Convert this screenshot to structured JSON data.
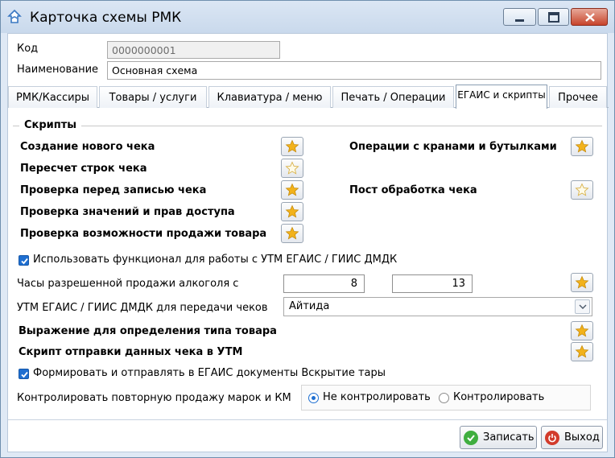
{
  "window": {
    "title": "Карточка схемы РМК",
    "controls": {
      "minimize_icon": "minimize-icon",
      "maximize_icon": "maximize-icon",
      "close_icon": "close-icon"
    }
  },
  "fields": {
    "code_label": "Код",
    "code_value": "0000000001",
    "name_label": "Наименование",
    "name_value": "Основная схема"
  },
  "tabs": [
    {
      "label": "РМК/Кассиры",
      "active": false
    },
    {
      "label": "Товары / услуги",
      "active": false
    },
    {
      "label": "Клавиатура / меню",
      "active": false
    },
    {
      "label": "Печать / Операции",
      "active": false
    },
    {
      "label": "ЕГАИС и скрипты",
      "active": true
    },
    {
      "label": "Прочее",
      "active": false
    }
  ],
  "scripts": {
    "group_title": "Скрипты",
    "left": [
      {
        "label": "Создание нового чека",
        "star_filled": true
      },
      {
        "label": "Пересчет строк чека",
        "star_filled": false
      },
      {
        "label": "Проверка перед записью чека",
        "star_filled": true
      },
      {
        "label": "Проверка значений и прав доступа",
        "star_filled": true
      },
      {
        "label": "Проверка возможности продажи товара",
        "star_filled": true
      }
    ],
    "right": [
      {
        "label": "Операции с кранами и бутылками",
        "star_filled": true
      },
      {
        "label": "Пост обработка чека",
        "star_filled": false
      }
    ]
  },
  "egais": {
    "use_utm_label": "Использовать функционал для работы с УТМ ЕГАИС / ГИИС ДМДК",
    "use_utm_checked": true,
    "alcohol_hours_label": "Часы разрешенной продажи алкоголя с",
    "alcohol_from": "8",
    "alcohol_to": "13",
    "utm_label": "УТМ ЕГАИС / ГИИС ДМДК для передачи чеков",
    "utm_value": "Айтида",
    "product_type_expr_label": "Выражение для определения типа товара",
    "send_script_label": "Скрипт отправки данных чека в УТМ",
    "send_opening_label": "Формировать и отправлять в ЕГАИС документы Вскрытие тары",
    "send_opening_checked": true,
    "repeat_sale_label": "Контролировать повторную продажу марок и КМ",
    "repeat_sale_options": [
      "Не контролировать",
      "Контролировать"
    ],
    "repeat_sale_selected": "Не контролировать"
  },
  "footer": {
    "save_label": "Записать",
    "exit_label": "Выход"
  },
  "colors": {
    "star": "#f2b21b",
    "accent": "#1f6fd1",
    "save_icon": "#3fae3f",
    "exit_icon": "#d23b2b"
  }
}
